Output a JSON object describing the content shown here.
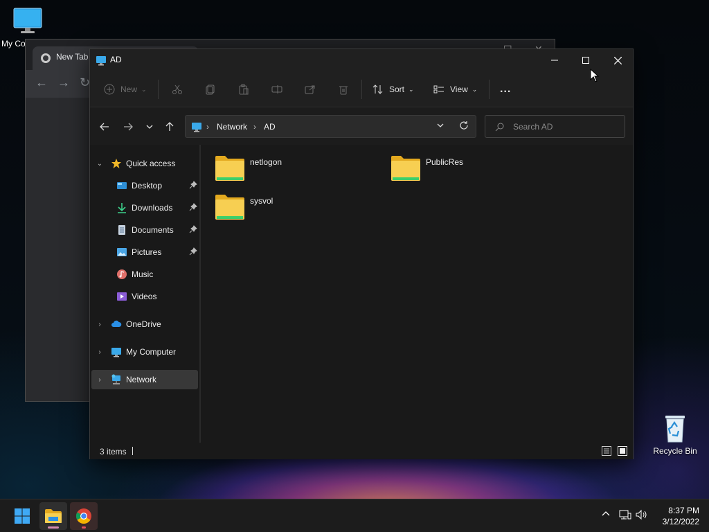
{
  "desktop": {
    "icons": [
      {
        "label": "My Computer"
      },
      {
        "label": "Recycle Bin"
      }
    ]
  },
  "chrome_window": {
    "tab_title": "New Tab"
  },
  "explorer": {
    "window_title": "AD",
    "command_bar": {
      "new_label": "New",
      "sort_label": "Sort",
      "view_label": "View",
      "more_label": "..."
    },
    "address_bar": {
      "breadcrumbs": [
        "Network",
        "AD"
      ],
      "search_placeholder": "Search AD"
    },
    "navigation": {
      "quick_access": "Quick access",
      "pinned": [
        {
          "label": "Desktop",
          "pinned": true
        },
        {
          "label": "Downloads",
          "pinned": true
        },
        {
          "label": "Documents",
          "pinned": true
        },
        {
          "label": "Pictures",
          "pinned": true
        },
        {
          "label": "Music",
          "pinned": false
        },
        {
          "label": "Videos",
          "pinned": false
        }
      ],
      "onedrive": "OneDrive",
      "my_computer": "My Computer",
      "network": "Network",
      "selected": "Network"
    },
    "files": [
      {
        "name": "netlogon",
        "type": "folder"
      },
      {
        "name": "PublicRes",
        "type": "folder"
      },
      {
        "name": "sysvol",
        "type": "folder"
      }
    ],
    "status": {
      "item_count": "3 items"
    }
  },
  "taskbar": {
    "apps": [
      "Start",
      "File Explorer",
      "Google Chrome"
    ],
    "clock": {
      "time": "8:37 PM",
      "date": "3/12/2022"
    }
  },
  "colors": {
    "folder_yellow": "#f4c542",
    "folder_green": "#3ccf6a",
    "accent_blue": "#1e90e6",
    "selection_bg": "#383838"
  }
}
